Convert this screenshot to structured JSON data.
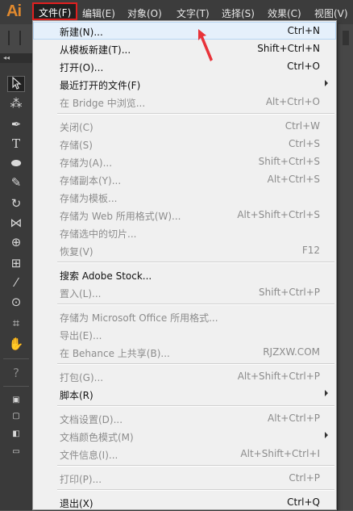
{
  "app": {
    "logo": "Ai"
  },
  "menubar": [
    {
      "label": "文件(F)",
      "active": true
    },
    {
      "label": "编辑(E)"
    },
    {
      "label": "对象(O)"
    },
    {
      "label": "文字(T)"
    },
    {
      "label": "选择(S)"
    },
    {
      "label": "效果(C)"
    },
    {
      "label": "视图(V)"
    }
  ],
  "tool_icons": [
    "selection-tool-icon",
    "magic-wand-icon",
    "pen-tool-icon",
    "type-tool-icon",
    "ellipse-tool-icon",
    "pencil-tool-icon",
    "rotate-tool-icon",
    "width-tool-icon",
    "shape-builder-icon",
    "perspective-grid-icon",
    "eyedropper-icon",
    "symbol-sprayer-icon",
    "artboard-tool-icon",
    "hand-tool-icon",
    "help-icon"
  ],
  "file_menu": [
    {
      "label": "新建(N)...",
      "shortcut": "Ctrl+N",
      "enabled": true,
      "highlighted": true
    },
    {
      "label": "从模板新建(T)...",
      "shortcut": "Shift+Ctrl+N",
      "enabled": true
    },
    {
      "label": "打开(O)...",
      "shortcut": "Ctrl+O",
      "enabled": true
    },
    {
      "label": "最近打开的文件(F)",
      "shortcut": "",
      "enabled": true,
      "submenu": true
    },
    {
      "label": "在 Bridge 中浏览...",
      "shortcut": "Alt+Ctrl+O",
      "enabled": false
    },
    {
      "separator": true
    },
    {
      "label": "关闭(C)",
      "shortcut": "Ctrl+W",
      "enabled": false
    },
    {
      "label": "存储(S)",
      "shortcut": "Ctrl+S",
      "enabled": false
    },
    {
      "label": "存储为(A)...",
      "shortcut": "Shift+Ctrl+S",
      "enabled": false
    },
    {
      "label": "存储副本(Y)...",
      "shortcut": "Alt+Ctrl+S",
      "enabled": false
    },
    {
      "label": "存储为模板...",
      "shortcut": "",
      "enabled": false
    },
    {
      "label": "存储为 Web 所用格式(W)...",
      "shortcut": "Alt+Shift+Ctrl+S",
      "enabled": false
    },
    {
      "label": "存储选中的切片...",
      "shortcut": "",
      "enabled": false
    },
    {
      "label": "恢复(V)",
      "shortcut": "F12",
      "enabled": false
    },
    {
      "separator": true
    },
    {
      "label": "搜索 Adobe Stock...",
      "shortcut": "",
      "enabled": true
    },
    {
      "label": "置入(L)...",
      "shortcut": "Shift+Ctrl+P",
      "enabled": false
    },
    {
      "separator": true
    },
    {
      "label": "存储为 Microsoft Office 所用格式...",
      "shortcut": "",
      "enabled": false
    },
    {
      "label": "导出(E)...",
      "shortcut": "",
      "enabled": false
    },
    {
      "label": "在 Behance 上共享(B)...",
      "shortcut": "RJZXW.COM",
      "enabled": false
    },
    {
      "separator": true
    },
    {
      "label": "打包(G)...",
      "shortcut": "Alt+Shift+Ctrl+P",
      "enabled": false
    },
    {
      "label": "脚本(R)",
      "shortcut": "",
      "enabled": true,
      "submenu": true
    },
    {
      "separator": true
    },
    {
      "label": "文档设置(D)...",
      "shortcut": "Alt+Ctrl+P",
      "enabled": false
    },
    {
      "label": "文档颜色模式(M)",
      "shortcut": "",
      "enabled": false,
      "submenu": true
    },
    {
      "label": "文件信息(I)...",
      "shortcut": "Alt+Shift+Ctrl+I",
      "enabled": false
    },
    {
      "separator": true
    },
    {
      "label": "打印(P)...",
      "shortcut": "Ctrl+P",
      "enabled": false
    },
    {
      "separator": true
    },
    {
      "label": "退出(X)",
      "shortcut": "Ctrl+Q",
      "enabled": true
    }
  ],
  "colors": {
    "highlight_box": "#e02020",
    "annotation_arrow": "#e8333a",
    "accent": "#e0892e"
  }
}
